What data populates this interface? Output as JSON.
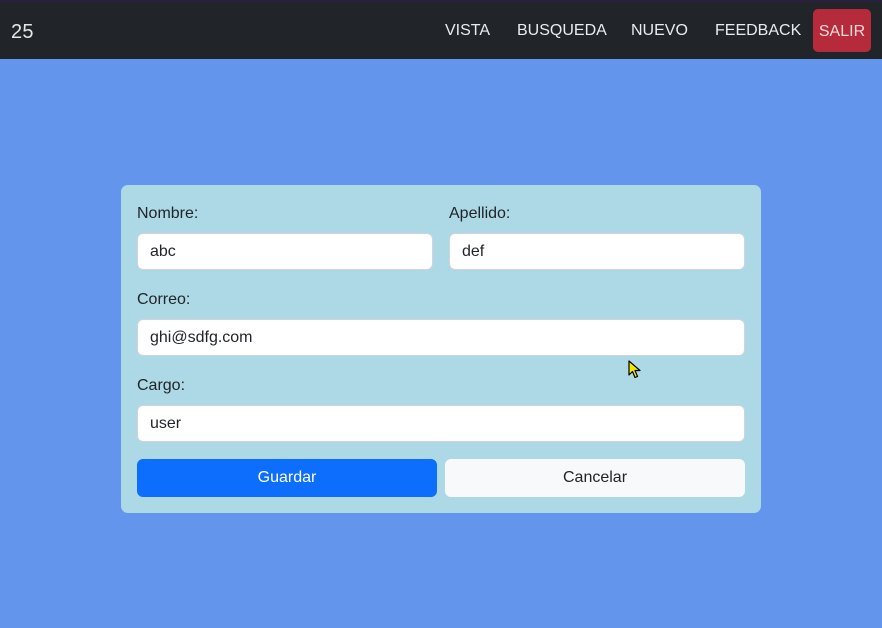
{
  "navbar": {
    "brand": "25",
    "links": [
      {
        "label": "VISTA"
      },
      {
        "label": "BUSQUEDA"
      },
      {
        "label": "NUEVO"
      },
      {
        "label": "FEEDBACK"
      }
    ],
    "logout_label": "SALIR"
  },
  "form": {
    "nombre": {
      "label": "Nombre:",
      "value": "abc"
    },
    "apellido": {
      "label": "Apellido:",
      "value": "def"
    },
    "correo": {
      "label": "Correo:",
      "value": "ghi@sdfg.com"
    },
    "cargo": {
      "label": "Cargo:",
      "value": "user"
    },
    "save_label": "Guardar",
    "cancel_label": "Cancelar"
  },
  "colors": {
    "page_background": "#6495ed",
    "navbar_background": "#212529",
    "card_background": "#add8e6",
    "primary": "#0d6efd",
    "danger": "#b52b3b",
    "light": "#f8f9fa"
  },
  "icons": {
    "cursor": "mouse-pointer-icon"
  }
}
